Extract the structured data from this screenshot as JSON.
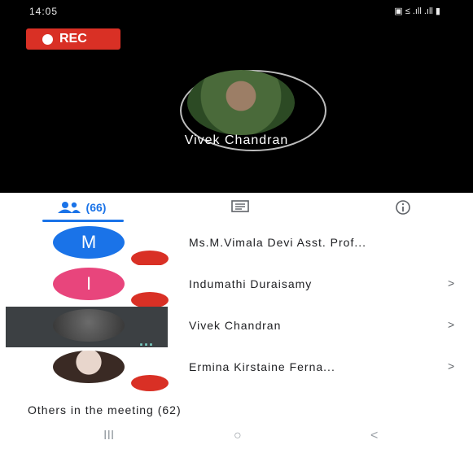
{
  "status_bar": {
    "time": "14:05",
    "indicators": "▣ ≤ .ıll .ıll ▮"
  },
  "recording": {
    "label": "REC",
    "color": "#d93025"
  },
  "speaker": {
    "name": "Vivek Chandran"
  },
  "tabs": {
    "people_count": "(66)",
    "people_icon": "people-icon",
    "chat_icon": "chat-icon",
    "info_icon": "info-icon",
    "accent": "#1a73e8"
  },
  "participants": [
    {
      "initial": "M",
      "name": "Ms.M.Vimala Devi Asst. Prof...",
      "avatar_color": "#1a73e8",
      "muted": true,
      "chevron": ""
    },
    {
      "initial": "I",
      "name": "Indumathi Duraisamy",
      "avatar_color": "#e8457c",
      "muted": true,
      "chevron": ">"
    },
    {
      "initial": "",
      "name": "Vivek Chandran",
      "avatar_color": "#5f6368",
      "muted": false,
      "speaking": "...",
      "chevron": ">"
    },
    {
      "initial": "",
      "name": "Ermina Kirstaine Ferna...",
      "avatar_color": "#d9c9bf",
      "muted": true,
      "chevron": ">"
    }
  ],
  "others": {
    "label": "Others in the meeting (62)"
  },
  "nav": {
    "recents": "III",
    "home": "○",
    "back": "<"
  }
}
